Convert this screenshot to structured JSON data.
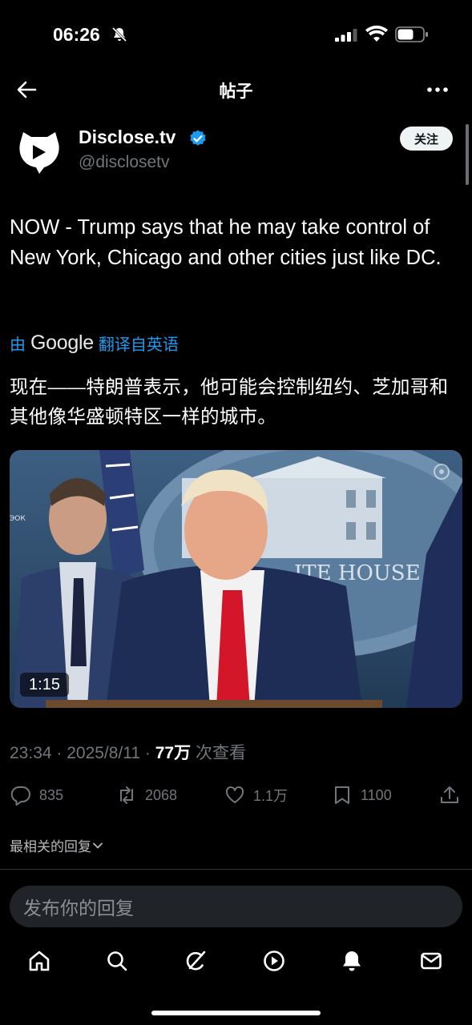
{
  "status_bar": {
    "time": "06:26"
  },
  "header": {
    "title": "帖子"
  },
  "author": {
    "name": "Disclose.tv",
    "handle": "@disclosetv",
    "follow_label": "关注"
  },
  "tweet": {
    "text": "NOW - Trump says that he may take control of New York, Chicago and other cities just like DC.",
    "translate_prefix": "由",
    "translate_brand": "Google",
    "translate_suffix": "翻译自英语",
    "translated_text": "现在——特朗普表示，他可能会控制纽约、芝加哥和其他像华盛顿特区一样的城市。",
    "video_duration": "1:15",
    "media_text_left": "ЭОК",
    "media_text_right": "ITE HOUSE",
    "timestamp": "23:34 · 2025/8/11 · ",
    "views_count": "77万",
    "views_label": " 次查看"
  },
  "actions": {
    "replies": "835",
    "reposts": "2068",
    "likes": "1.1万",
    "bookmarks": "1100"
  },
  "replies_sort_label": "最相关的回复",
  "reply_placeholder": "发布你的回复",
  "colors": {
    "accent": "#1d9bf0",
    "background": "#000000",
    "muted": "#71767b"
  }
}
